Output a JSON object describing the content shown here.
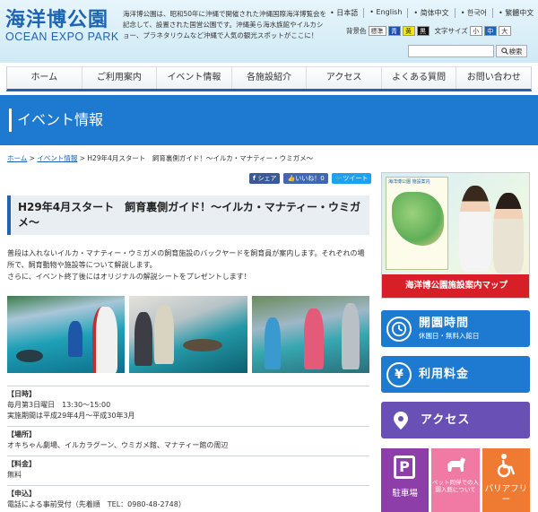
{
  "header": {
    "logo_ja": "海洋博公園",
    "logo_en": "OCEAN EXPO PARK",
    "intro": "海洋博公園は、昭和50年に沖縄で開催された沖縄国際海洋博覧会を記念して、設置された国営公園です。沖縄美ら海水族館やイルカショー、プラネタリウムなど沖縄で人気の観光スポットがここに！",
    "languages": [
      "日本語",
      "English",
      "简体中文",
      "한국어",
      "繁體中文"
    ],
    "bg_label": "背景色",
    "bg_options": [
      "標準",
      "青",
      "黄",
      "黒"
    ],
    "font_label": "文字サイズ",
    "font_options": [
      "小",
      "中",
      "大"
    ],
    "search_placeholder": "",
    "search_label": "検索"
  },
  "nav": {
    "items": [
      "ホーム",
      "ご利用案内",
      "イベント情報",
      "各施設紹介",
      "アクセス",
      "よくある質問",
      "お問い合わせ"
    ]
  },
  "banner": {
    "title": "イベント情報"
  },
  "breadcrumb": {
    "home": "ホーム",
    "sep": " > ",
    "events": "イベント情報",
    "current": "H29年4月スタート　飼育裏側ガイド！～イルカ・マナティー・ウミガメ～"
  },
  "social": {
    "share": "シェア",
    "like": "いいね！0",
    "tweet": "ツイート"
  },
  "article": {
    "title": "H29年4月スタート　飼育裏側ガイド！～イルカ・マナティー・ウミガメ～",
    "lead": [
      "普段は入れないイルカ・マナティー・ウミガメの飼育施設のバックヤードを飼育員が案内します。それぞれの場所で、飼育動物や施設等について解説します。",
      "さらに、イベント終了後にはオリジナルの解説シートをプレゼントします！"
    ],
    "details": [
      {
        "head": "【日時】",
        "lines": [
          "毎月第3日曜日　13:30～15:00",
          "実施期間は平成29年4月～平成30年3月"
        ]
      },
      {
        "head": "【場所】",
        "lines": [
          "オキちゃん劇場、イルカラグーン、ウミガメ館、マナティー館の周辺"
        ]
      },
      {
        "head": "【料金】",
        "lines": [
          "無料"
        ]
      },
      {
        "head": "【申込】",
        "lines": [
          "電話による事前受付（先着順　TEL：0980-48-2748）"
        ]
      }
    ]
  },
  "sidebar": {
    "map_banner": {
      "card_title": "海洋博公園 施設案内",
      "label": "海洋博公園施設案内マップ"
    },
    "hours": {
      "title": "開園時間",
      "sub": "休園日・無料入館日"
    },
    "fee": {
      "title": "利用料金"
    },
    "access": {
      "title": "アクセス"
    },
    "tiles": [
      {
        "label": "駐車場"
      },
      {
        "small": "ペット同伴での入園入館について"
      },
      {
        "label": "バリアフリー"
      }
    ]
  },
  "colors": {
    "primary_blue": "#1e7ad0",
    "logo_blue": "#1d64b3",
    "map_red": "#d61f26",
    "access_purple": "#6950b5",
    "parking_purple": "#8e3ea9",
    "pet_pink": "#f07aa4",
    "barrier_orange": "#ef7a32"
  },
  "icons": {
    "hours": "clock-icon",
    "fee": "yen-icon",
    "access": "map-pin-icon",
    "parking": "parking-icon",
    "pet": "dog-icon",
    "barrier": "wheelchair-icon",
    "search": "search-icon"
  }
}
